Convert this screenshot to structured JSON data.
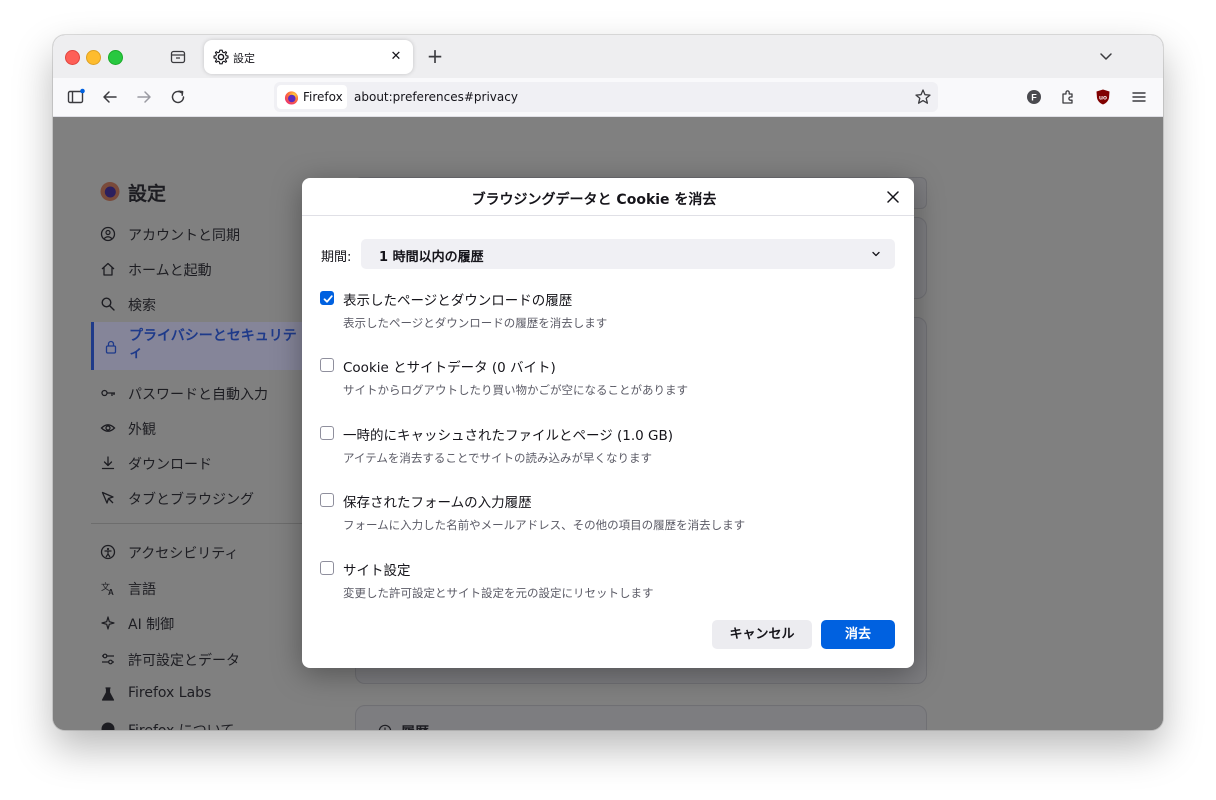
{
  "tab": {
    "title": "設定"
  },
  "urlbar": {
    "identity": "Firefox",
    "url": "about:preferences#privacy"
  },
  "sidebar": {
    "title": "設定",
    "items": [
      {
        "label": "アカウントと同期",
        "icon": "account-icon"
      },
      {
        "label": "ホームと起動",
        "icon": "home-icon"
      },
      {
        "label": "検索",
        "icon": "search-icon"
      },
      {
        "label": "プライバシーとセキュリティ",
        "icon": "lock-icon",
        "active": true
      },
      {
        "label": "パスワードと自動入力",
        "icon": "key-icon"
      },
      {
        "label": "外観",
        "icon": "eye-icon"
      },
      {
        "label": "ダウンロード",
        "icon": "download-icon"
      },
      {
        "label": "タブとブラウジング",
        "icon": "cursor-icon"
      },
      {
        "label": "アクセシビリティ",
        "icon": "accessibility-icon"
      },
      {
        "label": "言語",
        "icon": "language-icon"
      },
      {
        "label": "AI 制御",
        "icon": "sparkle-icon"
      },
      {
        "label": "許可設定とデータ",
        "icon": "sliders-icon"
      },
      {
        "label": "Firefox Labs",
        "icon": "flask-icon"
      },
      {
        "label": "Firefox について",
        "icon": "info-icon"
      }
    ],
    "panel_heading": "履歴"
  },
  "dialog": {
    "title": "ブラウジングデータと Cookie を消去",
    "period_label": "期間:",
    "period_value": "1 時間以内の履歴",
    "options": [
      {
        "label": "表示したページとダウンロードの履歴",
        "desc": "表示したページとダウンロードの履歴を消去します",
        "checked": true
      },
      {
        "label": "Cookie とサイトデータ (0 バイト)",
        "desc": "サイトからログアウトしたり買い物かごが空になることがあります",
        "checked": false
      },
      {
        "label": "一時的にキャッシュされたファイルとページ (1.0 GB)",
        "desc": "アイテムを消去することでサイトの読み込みが早くなります",
        "checked": false
      },
      {
        "label": "保存されたフォームの入力履歴",
        "desc": "フォームに入力した名前やメールアドレス、その他の項目の履歴を消去します",
        "checked": false
      },
      {
        "label": "サイト設定",
        "desc": "変更した許可設定とサイト設定を元の設定にリセットします",
        "checked": false
      }
    ],
    "cancel_label": "キャンセル",
    "clear_label": "消去"
  }
}
